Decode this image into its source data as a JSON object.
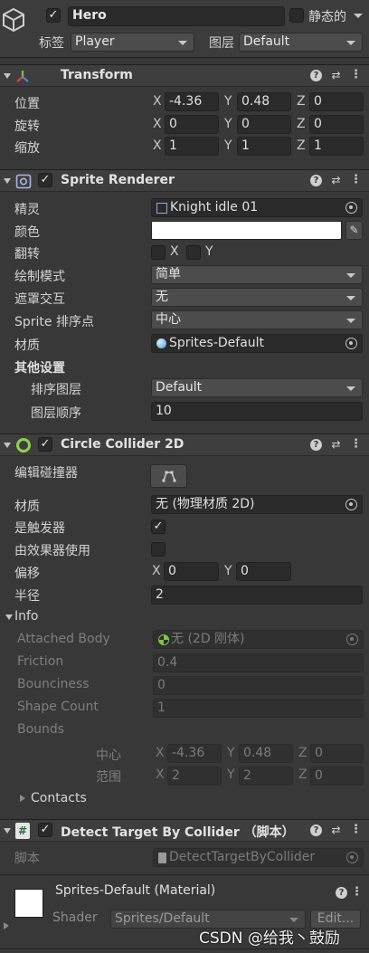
{
  "object": {
    "name": "Hero",
    "static_label": "静态的",
    "tag_label": "标签",
    "tag_value": "Player",
    "layer_label": "图层",
    "layer_value": "Default"
  },
  "transform": {
    "title": "Transform",
    "position_label": "位置",
    "rotation_label": "旋转",
    "scale_label": "缩放",
    "position": {
      "x": "-4.36",
      "y": "0.48",
      "z": "0"
    },
    "rotation": {
      "x": "0",
      "y": "0",
      "z": "0"
    },
    "scale": {
      "x": "1",
      "y": "1",
      "z": "1"
    }
  },
  "axes": {
    "x": "X",
    "y": "Y",
    "z": "Z"
  },
  "sprite_renderer": {
    "title": "Sprite Renderer",
    "sprite_label": "精灵",
    "sprite_value": "Knight idle 01",
    "color_label": "颜色",
    "color_value": "#ffffff",
    "flip_label": "翻转",
    "flip_x": "X",
    "flip_y": "Y",
    "draw_mode_label": "绘制模式",
    "draw_mode_value": "简单",
    "mask_label": "遮罩交互",
    "mask_value": "无",
    "sort_point_label": "Sprite 排序点",
    "sort_point_value": "中心",
    "material_label": "材质",
    "material_value": "Sprites-Default",
    "additional_label": "其他设置",
    "sorting_layer_label": "排序图层",
    "sorting_layer_value": "Default",
    "order_label": "图层顺序",
    "order_value": "10"
  },
  "circle_collider": {
    "title": "Circle Collider 2D",
    "edit_label": "编辑碰撞器",
    "material_label": "材质",
    "material_value": "无 (物理材质 2D)",
    "trigger_label": "是触发器",
    "trigger_checked": true,
    "effector_label": "由效果器使用",
    "effector_checked": false,
    "offset_label": "偏移",
    "offset": {
      "x": "0",
      "y": "0"
    },
    "radius_label": "半径",
    "radius_value": "2",
    "info_label": "Info",
    "attached_body_label": "Attached Body",
    "attached_body_value": "无 (2D 刚体)",
    "friction_label": "Friction",
    "friction_value": "0.4",
    "bounciness_label": "Bounciness",
    "bounciness_value": "0",
    "shape_count_label": "Shape Count",
    "shape_count_value": "1",
    "bounds_label": "Bounds",
    "center_label": "中心",
    "center": {
      "x": "-4.36",
      "y": "0.48",
      "z": "0"
    },
    "extent_label": "范围",
    "extent": {
      "x": "2",
      "y": "2",
      "z": "0"
    },
    "contacts_label": "Contacts"
  },
  "detect_script": {
    "title": "Detect Target By Collider （脚本）",
    "script_label": "脚本",
    "script_value": "DetectTargetByCollider"
  },
  "material": {
    "title": "Sprites-Default (Material)",
    "shader_label": "Shader",
    "shader_value": "Sprites/Default",
    "edit_label": "Edit..."
  },
  "watermark": "CSDN @给我丶鼓励",
  "icons": [
    "cube-icon",
    "transform-axes-icon",
    "sprite-renderer-icon",
    "circle-collider-icon",
    "script-icon",
    "help-icon",
    "preset-icon",
    "kebab-icon",
    "picker-icon",
    "eyedropper-icon",
    "edit-collider-icon"
  ]
}
